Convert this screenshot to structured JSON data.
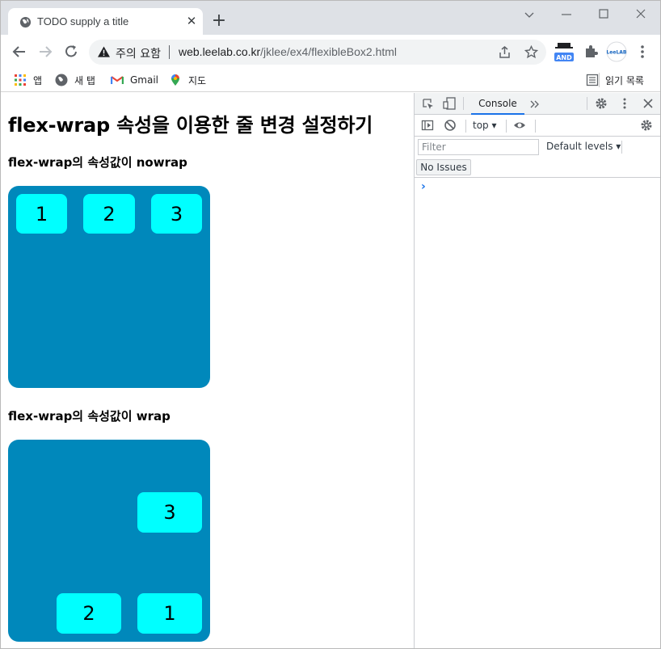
{
  "browser": {
    "tab_title": "TODO supply a title",
    "security_label": "주의 요함",
    "url_host": "web.leelab.co.kr",
    "url_path": "/jklee/ex4/flexibleBox2.html",
    "extension_badge": "AND",
    "profile_label": "LeeLAB"
  },
  "bookmarks": {
    "apps": "앱",
    "new_tab": "새 탭",
    "gmail": "Gmail",
    "maps": "지도",
    "reading_list": "읽기 목록"
  },
  "page": {
    "heading": "flex-wrap 속성을 이용한 줄 변경 설정하기",
    "section1_title": "flex-wrap의 속성값이 nowrap",
    "section1_items": [
      "1",
      "2",
      "3"
    ],
    "section2_title": "flex-wrap의 속성값이 wrap",
    "section2_items": [
      "1",
      "2",
      "3"
    ]
  },
  "devtools": {
    "tab_console": "Console",
    "context": "top",
    "filter_placeholder": "Filter",
    "levels": "Default levels",
    "issues": "No Issues",
    "prompt": "›"
  },
  "colors": {
    "flex_container": "#0088bb",
    "flex_item": "#00ffff",
    "accent": "#1a73e8"
  }
}
